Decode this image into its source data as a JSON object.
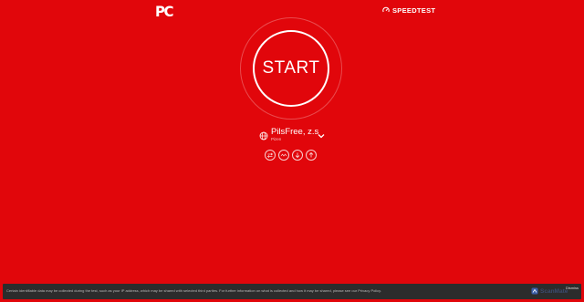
{
  "header": {
    "logo_text": "PC",
    "speedtest_label": "SPEEDTEST"
  },
  "start_button": {
    "label": "START"
  },
  "server": {
    "name": "PilsFree, z.s",
    "location": "Pizen"
  },
  "connection_mode_icons": [
    "multi-connection-icon",
    "ping-icon",
    "download-icon",
    "upload-icon"
  ],
  "consent": {
    "text": "Certain identifiable data may be collected during the test, such as your IP address, which may be shared with selected third parties. For further information on what is collected and how it may be shared, please see our Privacy Policy.",
    "brand": "ScanMate",
    "dismiss_label": "Dismiss"
  },
  "colors": {
    "background": "#e1060b",
    "foreground": "#ffffff",
    "consent_bar": "#2c2c2c"
  }
}
